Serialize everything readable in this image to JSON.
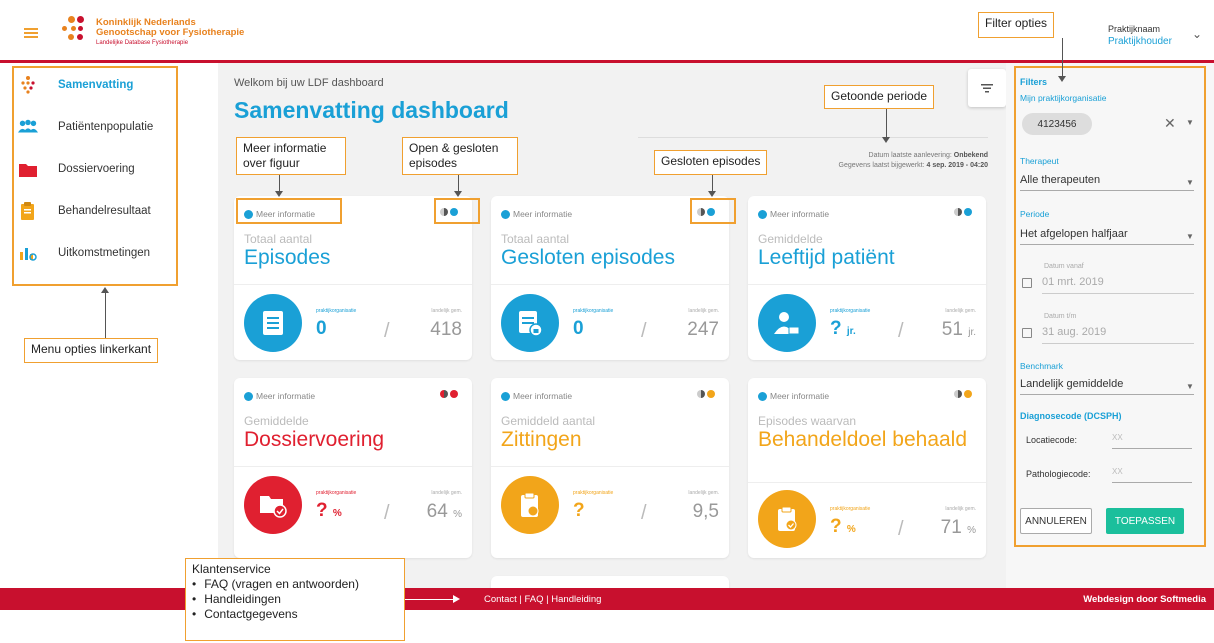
{
  "brand": {
    "line1": "Koninklijk Nederlands",
    "line2": "Genootschap voor Fysiotherapie",
    "line3": "Landelijke Database Fysiotherapie"
  },
  "user": {
    "practice": "Praktijknaam",
    "holder": "Praktijkhouder"
  },
  "sidebar": {
    "items": [
      {
        "label": "Samenvatting",
        "icon": "summary-icon",
        "active": true
      },
      {
        "label": "Patiëntenpopulatie",
        "icon": "people-icon"
      },
      {
        "label": "Dossiervoering",
        "icon": "folder-icon"
      },
      {
        "label": "Behandelresultaat",
        "icon": "clipboard-icon"
      },
      {
        "label": "Uitkomstmetingen",
        "icon": "bar-chart-icon"
      }
    ]
  },
  "main": {
    "welcome": "Welkom bij uw LDF dashboard",
    "title": "Samenvatting dashboard",
    "info1_label": "Datum laatste aanlevering:",
    "info1_value": "Onbekend",
    "info2_label": "Gegevens laatst bijgewerkt:",
    "info2_value": "4 sep. 2019 - 04:20"
  },
  "cards": [
    {
      "more": "Meer informatie",
      "sub": "Totaal aantal",
      "big": "Episodes",
      "color": "#1aa0d6",
      "p_label": "praktijkorganisatie",
      "p_value": "0",
      "p_unit": "",
      "l_label": "landelijk gem.",
      "l_value": "418",
      "l_unit": ""
    },
    {
      "more": "Meer informatie",
      "sub": "Totaal aantal",
      "big": "Gesloten episodes",
      "color": "#1aa0d6",
      "p_label": "praktijkorganisatie",
      "p_value": "0",
      "p_unit": "",
      "l_label": "landelijk gem.",
      "l_value": "247",
      "l_unit": ""
    },
    {
      "more": "Meer informatie",
      "sub": "Gemiddelde",
      "big": "Leeftijd patiënt",
      "color": "#1aa0d6",
      "p_label": "praktijkorganisatie",
      "p_value": "?",
      "p_unit": "jr.",
      "l_label": "landelijk gem.",
      "l_value": "51",
      "l_unit": "jr."
    },
    {
      "more": "Meer informatie",
      "sub": "Gemiddelde",
      "big": "Dossiervoering",
      "color": "#e02030",
      "p_label": "praktijkorganisatie",
      "p_value": "?",
      "p_unit": "%",
      "l_label": "landelijk gem.",
      "l_value": "64",
      "l_unit": "%"
    },
    {
      "more": "Meer informatie",
      "sub": "Gemiddeld aantal",
      "big": "Zittingen",
      "color": "#f2a51a",
      "p_label": "praktijkorganisatie",
      "p_value": "?",
      "p_unit": "",
      "l_label": "landelijk gem.",
      "l_value": "9,5",
      "l_unit": ""
    },
    {
      "more": "Meer informatie",
      "sub": "Episodes waarvan",
      "big": "Behandeldoel behaald",
      "color": "#f2a51a",
      "p_label": "praktijkorganisatie",
      "p_value": "?",
      "p_unit": "%",
      "l_label": "landelijk gem.",
      "l_value": "71",
      "l_unit": "%"
    }
  ],
  "filters": {
    "heading": "Filters",
    "org_label": "Mijn praktijkorganisatie",
    "org_chip": "4123456",
    "therapist_label": "Therapeut",
    "therapist_value": "Alle therapeuten",
    "period_label": "Periode",
    "period_value": "Het afgelopen halfjaar",
    "date_from_label": "Datum vanaf",
    "date_from_value": "01 mrt. 2019",
    "date_to_label": "Datum t/m",
    "date_to_value": "31 aug. 2019",
    "benchmark_label": "Benchmark",
    "benchmark_value": "Landelijk gemiddelde",
    "diag_label": "Diagnosecode (DCSPH)",
    "loc_label": "Locatiecode:",
    "loc_placeholder": "XX",
    "path_label": "Pathologiecode:",
    "path_placeholder": "XX",
    "cancel": "ANNULEREN",
    "apply": "TOEPASSEN"
  },
  "footer": {
    "contact": "Contact",
    "faq": "FAQ",
    "manual": "Handleiding",
    "sep": "|",
    "credit": "Webdesign door Softmedia"
  },
  "annotations": {
    "filter_opties": "Filter opties",
    "getoonde_periode": "Getoonde periode",
    "meer_info": "Meer informatie over figuur",
    "open_gesloten": "Open & gesloten episodes",
    "gesloten": "Gesloten episodes",
    "menu": "Menu opties linkerkant",
    "klantenservice_title": "Klantenservice",
    "klantenservice_items": [
      "FAQ (vragen en antwoorden)",
      "Handleidingen",
      "Contactgegevens"
    ]
  },
  "colors": {
    "blue": "#1aa0d6",
    "red": "#e02030",
    "orange": "#f2a51a",
    "brand_red": "#c8102e",
    "green": "#1bbf9c",
    "annotation": "#f0a030"
  }
}
